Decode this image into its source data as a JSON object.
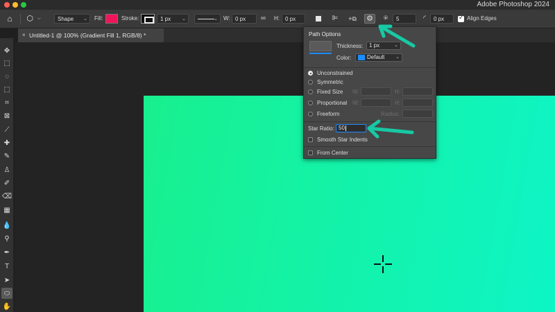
{
  "app": {
    "title": "Adobe Photoshop 2024"
  },
  "options_bar": {
    "mode": "Shape",
    "fill_label": "Fill:",
    "fill_color": "#f0145a",
    "stroke_label": "Stroke:",
    "stroke_width": "1 px",
    "width_label": "W:",
    "width_value": "0 px",
    "height_label": "H:",
    "height_value": "0 px",
    "sides_value": "5",
    "radius_value": "0 px",
    "align_edges": "Align Edges"
  },
  "document_tab": {
    "title": "Untitled-1 @ 100% (Gradient Fill 1, RGB/8) *",
    "close": "×"
  },
  "path_options": {
    "title": "Path Options",
    "thickness_label": "Thickness:",
    "thickness_value": "1 px",
    "color_label": "Color:",
    "color_value": "Default",
    "color_swatch": "#1c8cff",
    "unconstrained": "Unconstrained",
    "symmetric": "Symmetric",
    "fixed_size": "Fixed Size",
    "proportional": "Proportional",
    "freeform": "Freeform",
    "w_label": "W:",
    "h_label": "H:",
    "radius_label": "Radius:",
    "star_ratio_label": "Star Ratio:",
    "star_ratio_value": "50",
    "smooth_star_indents": "Smooth Star Indents",
    "from_center": "From Center"
  },
  "canvas": {
    "gradient_start": "#18f08e",
    "gradient_end": "#0ef5c6"
  },
  "annotation_color": "#17c9a4"
}
